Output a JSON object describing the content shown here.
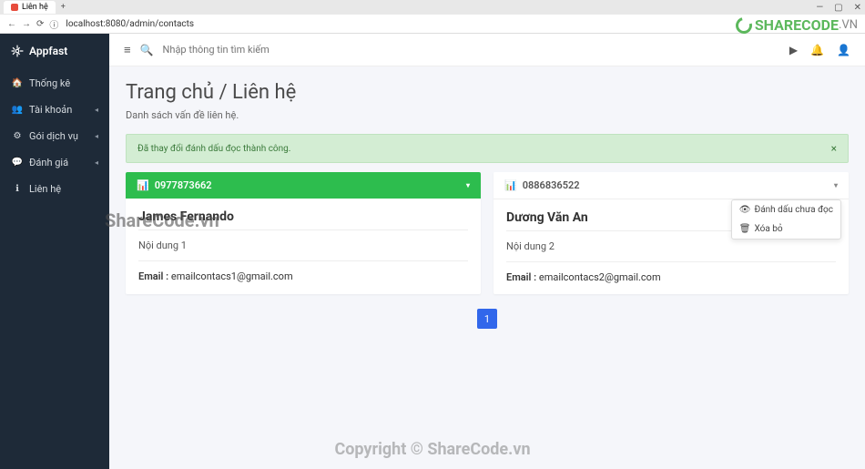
{
  "browser": {
    "tab_title": "Liên hệ",
    "url": "localhost:8080/admin/contacts"
  },
  "watermark": {
    "logo_main": "SHARECODE",
    "logo_suffix": ".VN",
    "wm1": "ShareCode.vn",
    "wm2": "Copyright © ShareCode.vn"
  },
  "sidebar": {
    "brand": "Appfast",
    "items": [
      {
        "label": "Thống kê",
        "icon": "🏠",
        "has_chev": false
      },
      {
        "label": "Tài khoản",
        "icon": "👥",
        "has_chev": true
      },
      {
        "label": "Gói dịch vụ",
        "icon": "⚙",
        "has_chev": true
      },
      {
        "label": "Đánh giá",
        "icon": "💬",
        "has_chev": true
      },
      {
        "label": "Liên hệ",
        "icon": "ℹ",
        "has_chev": false
      }
    ]
  },
  "topbar": {
    "search_placeholder": "Nhập thông tin tìm kiếm"
  },
  "page": {
    "title": "Trang chủ / Liên hệ",
    "subtitle": "Danh sách vấn đề liên hệ.",
    "alert": "Đã thay đổi đánh dấu đọc thành công."
  },
  "cards": [
    {
      "phone": "0977873662",
      "name": "James Fernando",
      "content": "Nội dung 1",
      "email_label": "Email :",
      "email": "emailcontacs1@gmail.com",
      "header_class": "green"
    },
    {
      "phone": "0886836522",
      "name": "Dương Văn An",
      "content": "Nội dung 2",
      "email_label": "Email :",
      "email": "emailcontacs2@gmail.com",
      "header_class": "white"
    }
  ],
  "dropdown": {
    "item1": "Đánh dấu chưa đọc",
    "item2": "Xóa bỏ"
  },
  "pagination": {
    "page": "1"
  }
}
